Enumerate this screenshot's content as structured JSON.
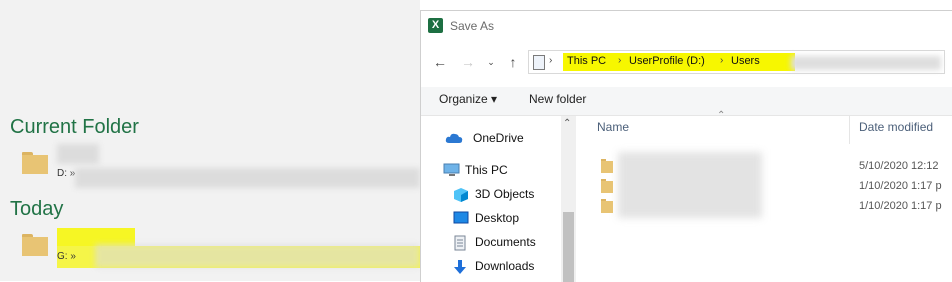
{
  "backstage": {
    "current_folder_heading": "Current Folder",
    "current_folder_path": "D: »",
    "today_heading": "Today",
    "today_path": "G: »"
  },
  "dialog": {
    "title": "Save As",
    "breadcrumb": [
      "This PC",
      "UserProfile (D:)",
      "Users"
    ],
    "toolbar": {
      "organize_label": "Organize ▾",
      "new_folder_label": "New folder"
    },
    "nav_items": [
      {
        "label": "OneDrive",
        "icon": "onedrive-icon"
      },
      {
        "label": "This PC",
        "icon": "pc-icon"
      },
      {
        "label": "3D Objects",
        "icon": "3d-objects-icon"
      },
      {
        "label": "Desktop",
        "icon": "desktop-icon"
      },
      {
        "label": "Documents",
        "icon": "documents-icon"
      },
      {
        "label": "Downloads",
        "icon": "downloads-icon"
      }
    ],
    "columns": {
      "name": "Name",
      "date_modified": "Date modified"
    },
    "rows": [
      {
        "date": "5/10/2020 12:12"
      },
      {
        "date": "1/10/2020 1:17 p"
      },
      {
        "date": "1/10/2020 1:17 p"
      }
    ]
  },
  "colors": {
    "excel_green": "#217346",
    "highlight": "#f7f700",
    "folder": "#e8c474"
  }
}
